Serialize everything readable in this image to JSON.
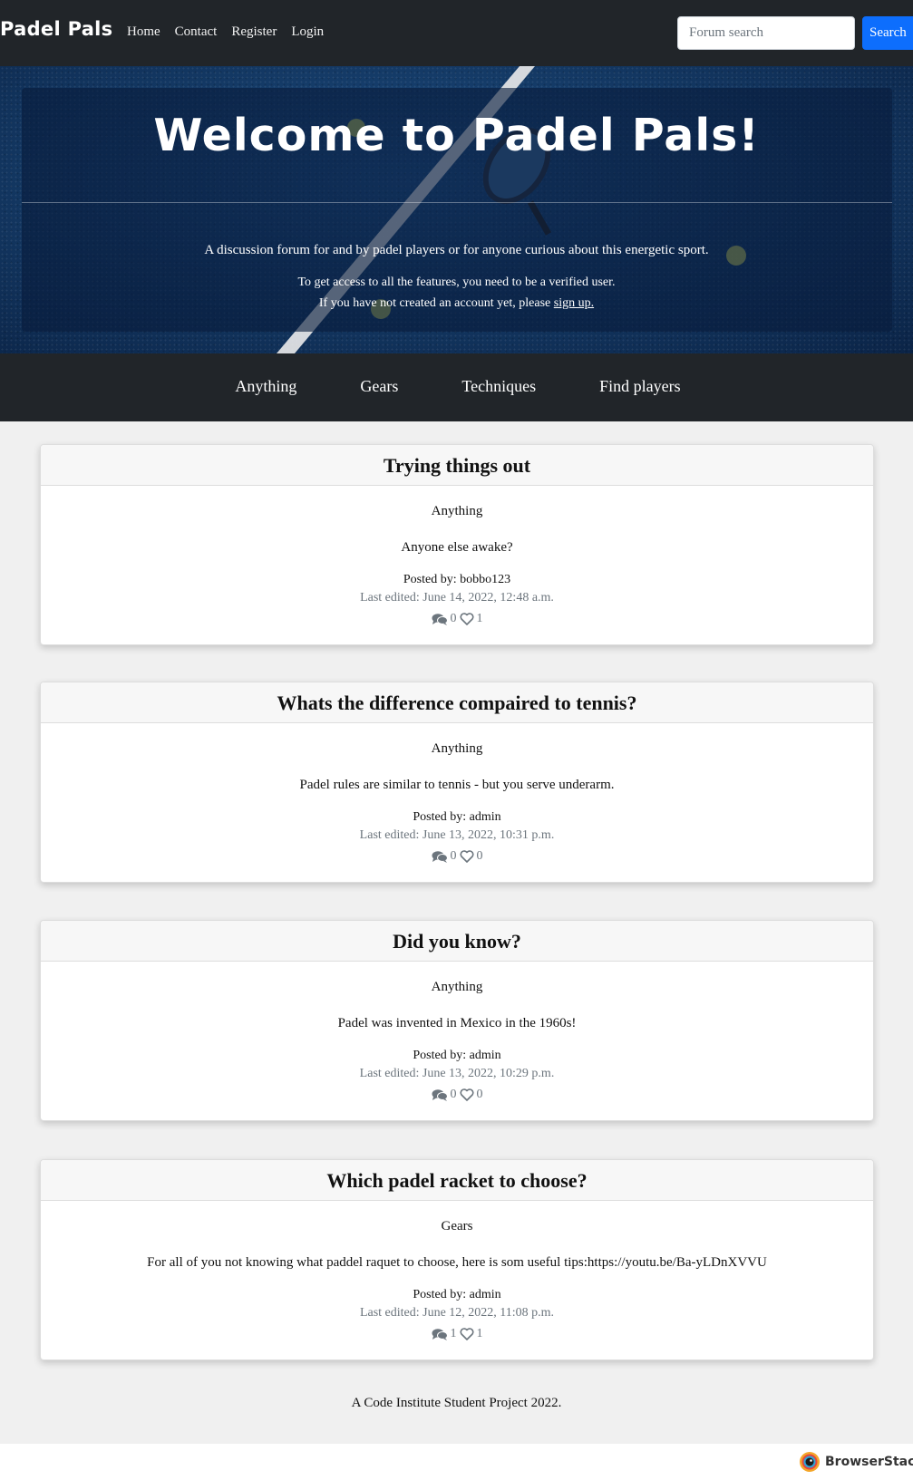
{
  "navbar": {
    "brand": "Padel Pals",
    "links": [
      "Home",
      "Contact",
      "Register",
      "Login"
    ],
    "search_placeholder": "Forum search",
    "search_button": "Search"
  },
  "hero": {
    "title": "Welcome to Padel Pals!",
    "line1": "A discussion forum for and by padel players or for anyone curious about this energetic sport.",
    "line2": "To get access to all the features, you need to be a verified user.",
    "line3_prefix": "If you have not created an account yet, please ",
    "signup_link": "sign up."
  },
  "categories": [
    "Anything",
    "Gears",
    "Techniques",
    "Find players"
  ],
  "posts": [
    {
      "title": "Trying things out",
      "category": "Anything",
      "excerpt": "Anyone else awake?",
      "author": "Posted by: bobbo123",
      "edited": "Last edited: June 14, 2022, 12:48 a.m.",
      "comments": "0",
      "likes": "1"
    },
    {
      "title": "Whats the difference compaired to tennis?",
      "category": "Anything",
      "excerpt": "Padel rules are similar to tennis - but you serve underarm.",
      "author": "Posted by: admin",
      "edited": "Last edited: June 13, 2022, 10:31 p.m.",
      "comments": "0",
      "likes": "0"
    },
    {
      "title": "Did you know?",
      "category": "Anything",
      "excerpt": "Padel was invented in Mexico in the 1960s!",
      "author": "Posted by: admin",
      "edited": "Last edited: June 13, 2022, 10:29 p.m.",
      "comments": "0",
      "likes": "0"
    },
    {
      "title": "Which padel racket to choose?",
      "category": "Gears",
      "excerpt": "For all of you not knowing what paddel raquet to choose, here is som useful tips:https://youtu.be/Ba-yLDnXVVU",
      "author": "Posted by: admin",
      "edited": "Last edited: June 12, 2022, 11:08 p.m.",
      "comments": "1",
      "likes": "1"
    }
  ],
  "footer": {
    "text": "A Code Institute Student Project 2022."
  },
  "browserstack": {
    "label": "BrowserStack"
  },
  "icons": {
    "comments": "comments-icon",
    "likes": "heart-icon"
  }
}
